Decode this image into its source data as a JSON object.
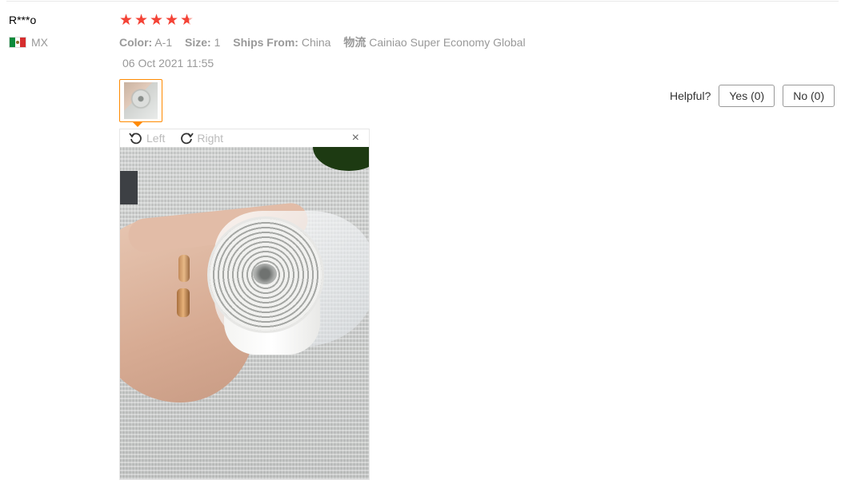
{
  "review": {
    "user_name": "R***o",
    "country_code": "MX",
    "rating": 5,
    "attributes": [
      {
        "key": "Color:",
        "value": "A-1"
      },
      {
        "key": "Size:",
        "value": "1"
      },
      {
        "key": "Ships From:",
        "value": "China"
      },
      {
        "key": "物流",
        "value": "Cainiao Super Economy Global"
      }
    ],
    "date": "06 Oct 2021 11:55"
  },
  "viewer": {
    "rotate_left_label": "Left",
    "rotate_right_label": "Right",
    "close_label": "×"
  },
  "helpful": {
    "label": "Helpful?",
    "yes_label": "Yes (0)",
    "no_label": "No (0)"
  },
  "icons": {
    "star": "star-icon",
    "flag": "mexico-flag-icon",
    "rotate_left": "rotate-left-icon",
    "rotate_right": "rotate-right-icon",
    "close": "close-icon"
  },
  "colors": {
    "star": "#f44336",
    "thumb_border": "#ff8a00",
    "muted_text": "#999999"
  }
}
